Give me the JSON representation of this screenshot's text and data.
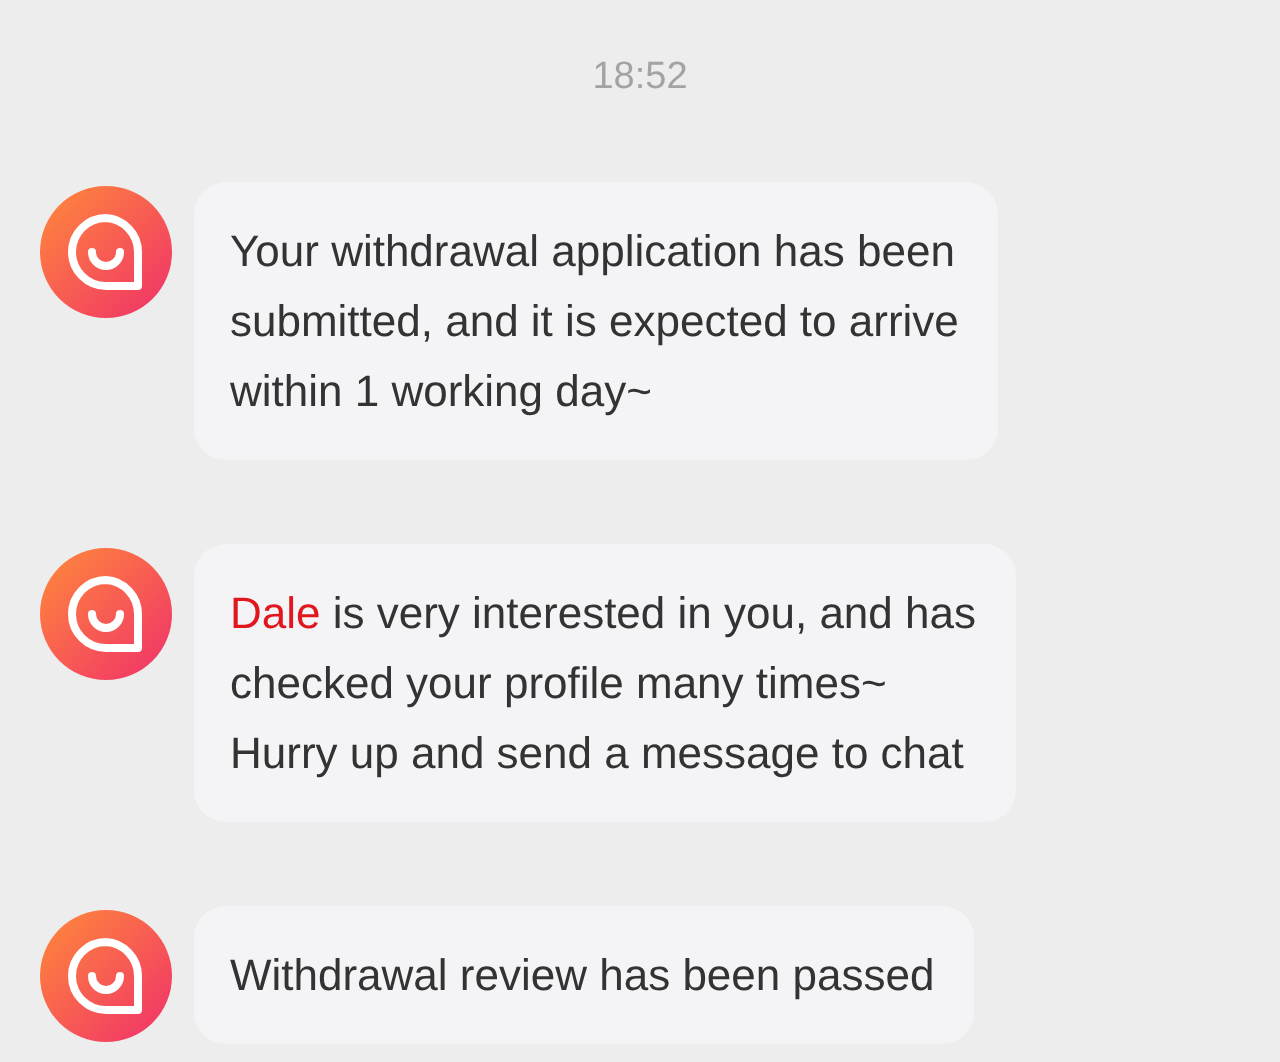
{
  "timestamp": "18:52",
  "messages": [
    {
      "lines": [
        "Your withdrawal application has been",
        "submitted, and it is expected to arrive",
        "within 1 working day~"
      ]
    },
    {
      "sender_name": "Dale",
      "lines": [
        " is very interested in you, and has",
        "checked your profile many times~",
        "Hurry up and send a message to chat"
      ]
    },
    {
      "lines": [
        "Withdrawal review has been passed"
      ]
    }
  ]
}
